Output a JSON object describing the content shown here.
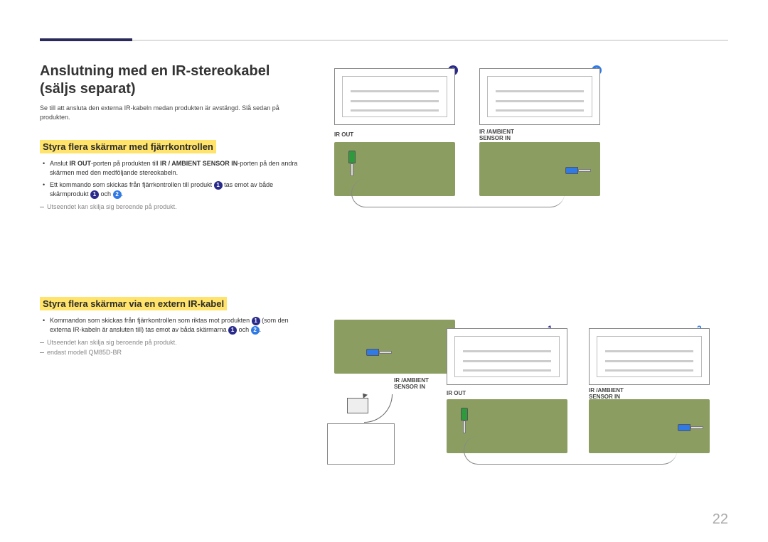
{
  "header": {
    "title_line1": "Anslutning med en IR-stereokabel",
    "title_line2": "(säljs separat)"
  },
  "intro": "Se till att ansluta den externa IR-kabeln medan produkten är avstängd. Slå sedan på produkten.",
  "section1": {
    "heading": "Styra flera skärmar med fjärrkontrollen",
    "bullets": [
      {
        "pre": "Anslut ",
        "b1": "IR OUT",
        "mid1": "-porten på produkten till ",
        "b2": "IR / AMBIENT SENSOR IN",
        "mid2": "-porten på den andra skärmen med den medföljande stereokabeln."
      },
      {
        "text_a": "Ett kommando som skickas från fjärrkontrollen till produkt ",
        "num1": "1",
        "text_b": " tas emot av både skärmprodukt ",
        "num2": "1",
        "text_c": " och ",
        "num3": "2",
        "text_d": "."
      }
    ],
    "note": "Utseendet kan skilja sig beroende på produkt."
  },
  "section2": {
    "heading": "Styra flera skärmar via en extern IR-kabel",
    "bullets": [
      {
        "text_a": "Kommandon som skickas från fjärrkontrollen som riktas mot produkten ",
        "num1": "1",
        "text_b": " (som den externa IR-kabeln är ansluten till) tas emot av båda skärmarna ",
        "num2": "1",
        "text_c": " och ",
        "num3": "2",
        "text_d": "."
      }
    ],
    "note1": "Utseendet kan skilja sig beroende på produkt.",
    "note2": "endast modell QM85D-BR"
  },
  "diagram_top": {
    "tag1": "1",
    "tag2": "2",
    "label_left": "IR OUT",
    "label_right_l1": "IR /AMBIENT",
    "label_right_l2": "SENSOR IN"
  },
  "diagram_bottom": {
    "tag1": "1",
    "tag2": "2",
    "label_upper_l1": "IR /AMBIENT",
    "label_upper_l2": "SENSOR IN",
    "label_mid": "IR OUT",
    "label_right_l1": "IR /AMBIENT",
    "label_right_l2": "SENSOR IN"
  },
  "page_number": "22"
}
